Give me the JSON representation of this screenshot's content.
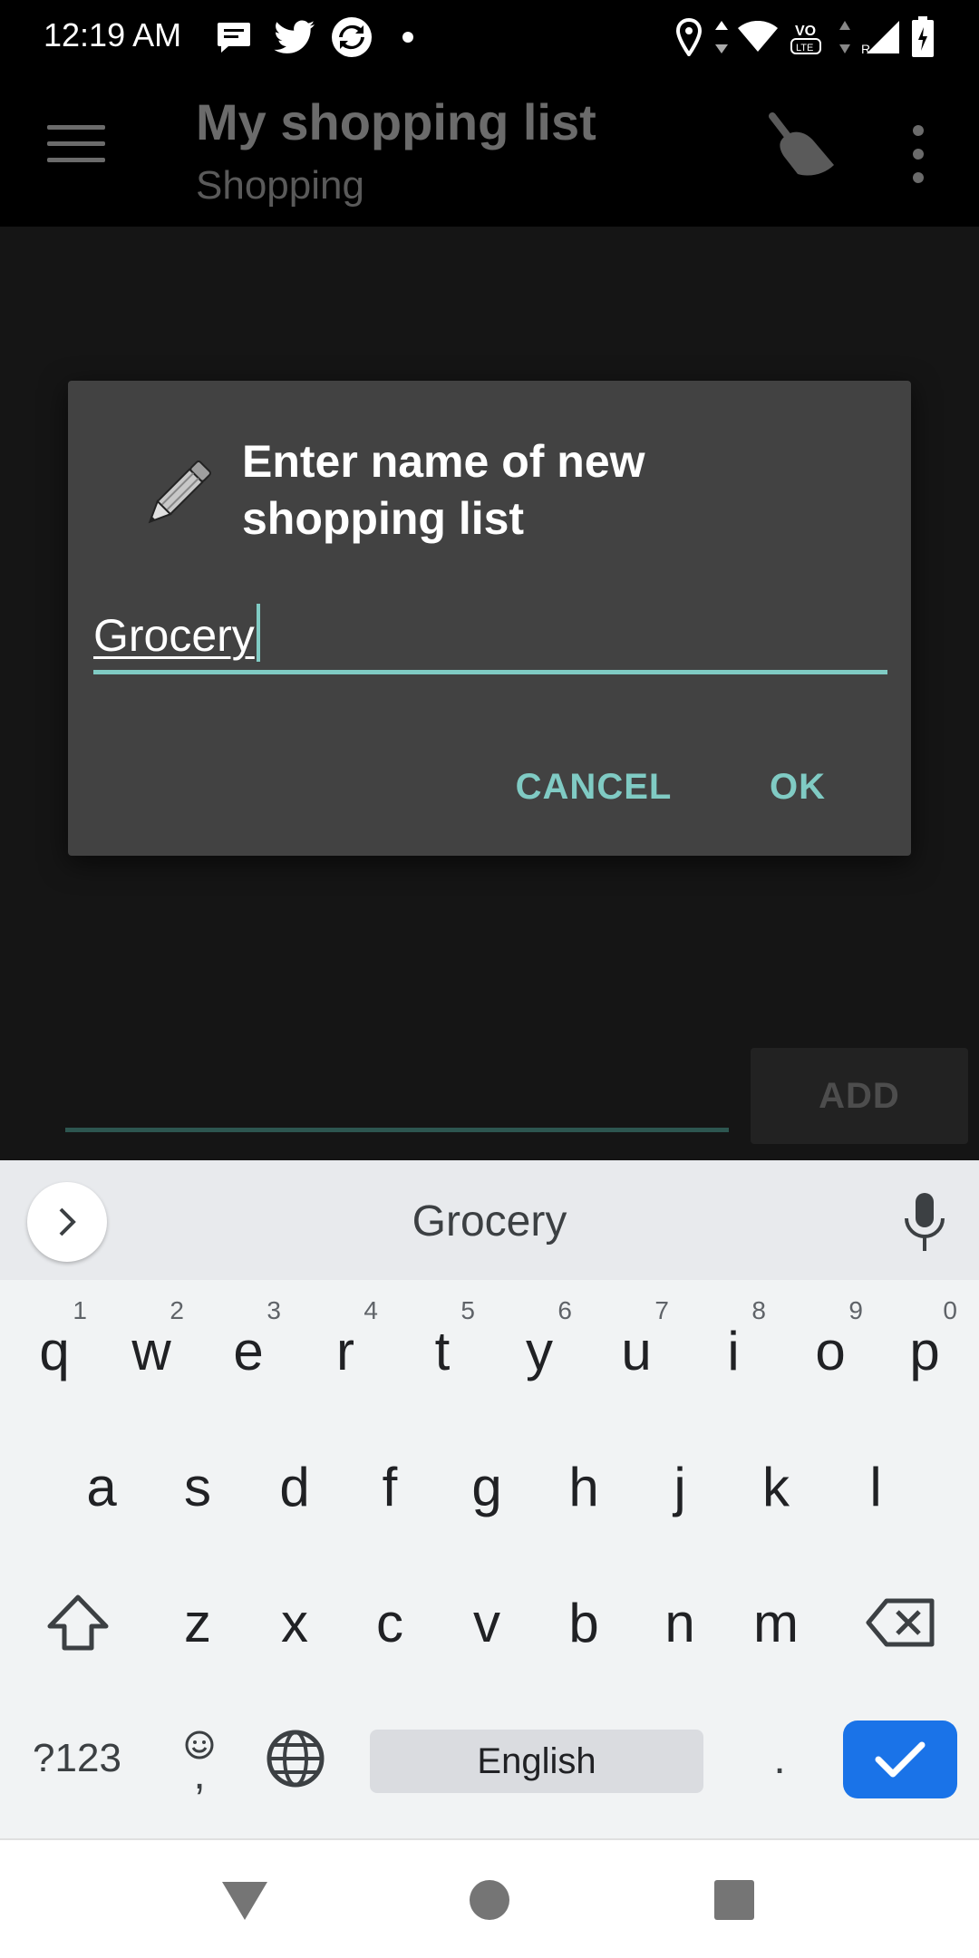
{
  "status_bar": {
    "time": "12:19 AM",
    "icons": [
      "message-icon",
      "twitter-icon",
      "sync-app-icon",
      "dot-icon",
      "location-icon",
      "data-arrows-icon",
      "wifi-icon",
      "volte-icon",
      "signal-icon",
      "battery-icon"
    ]
  },
  "toolbar": {
    "title": "My shopping list",
    "subtitle": "Shopping",
    "menu_icon": "hamburger-menu-icon",
    "clean_icon": "broom-icon",
    "overflow_icon": "more-vert-icon"
  },
  "content": {
    "add_button": "ADD",
    "add_input_value": ""
  },
  "dialog": {
    "icon": "pencil-icon",
    "title": "Enter name of new shopping list",
    "input_value": "Grocery",
    "cancel_label": "CANCEL",
    "ok_label": "OK",
    "accent_color": "#80cbc4"
  },
  "keyboard": {
    "suggestion": "Grocery",
    "row1": [
      {
        "key": "q",
        "hint": "1"
      },
      {
        "key": "w",
        "hint": "2"
      },
      {
        "key": "e",
        "hint": "3"
      },
      {
        "key": "r",
        "hint": "4"
      },
      {
        "key": "t",
        "hint": "5"
      },
      {
        "key": "y",
        "hint": "6"
      },
      {
        "key": "u",
        "hint": "7"
      },
      {
        "key": "i",
        "hint": "8"
      },
      {
        "key": "o",
        "hint": "9"
      },
      {
        "key": "p",
        "hint": "0"
      }
    ],
    "row2": [
      "a",
      "s",
      "d",
      "f",
      "g",
      "h",
      "j",
      "k",
      "l"
    ],
    "row3": [
      "z",
      "x",
      "c",
      "v",
      "b",
      "n",
      "m"
    ],
    "symbols_label": "?123",
    "comma_label": ",",
    "space_label": "English",
    "period_label": ".",
    "enter_color": "#1a73e8"
  },
  "navbar": {
    "buttons": [
      "back-icon",
      "home-icon",
      "recents-icon"
    ]
  }
}
